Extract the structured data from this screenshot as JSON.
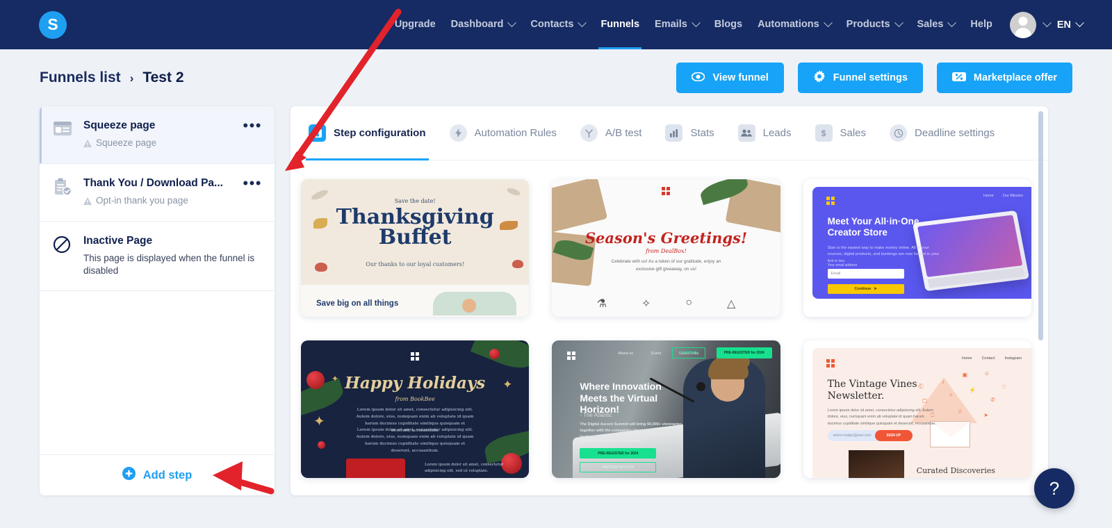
{
  "brand": {
    "logo_letter": "S",
    "accent": "#17a3f7",
    "navy": "#162b63"
  },
  "topnav": {
    "items": [
      {
        "label": "Upgrade",
        "caret": false,
        "active": false
      },
      {
        "label": "Dashboard",
        "caret": true,
        "active": false
      },
      {
        "label": "Contacts",
        "caret": true,
        "active": false
      },
      {
        "label": "Funnels",
        "caret": false,
        "active": true
      },
      {
        "label": "Emails",
        "caret": true,
        "active": false
      },
      {
        "label": "Blogs",
        "caret": false,
        "active": false
      },
      {
        "label": "Automations",
        "caret": true,
        "active": false
      },
      {
        "label": "Products",
        "caret": true,
        "active": false
      },
      {
        "label": "Sales",
        "caret": true,
        "active": false
      },
      {
        "label": "Help",
        "caret": false,
        "active": false
      }
    ],
    "language": "EN"
  },
  "header": {
    "breadcrumb_root": "Funnels list",
    "breadcrumb_sep": "›",
    "breadcrumb_current": "Test 2",
    "actions": [
      {
        "label": "View funnel",
        "icon": "eye-icon"
      },
      {
        "label": "Funnel settings",
        "icon": "gear-icon"
      },
      {
        "label": "Marketplace offer",
        "icon": "ticket-percent-icon"
      }
    ]
  },
  "sidebar": {
    "steps": [
      {
        "title": "Squeeze page",
        "subtitle": "Squeeze page",
        "warning": true,
        "selected": true,
        "icon": "squeeze-page-icon",
        "menu": "•••"
      },
      {
        "title": "Thank You / Download Pa...",
        "subtitle": "Opt-in thank you page",
        "warning": true,
        "selected": false,
        "icon": "thank-you-page-icon",
        "menu": "•••"
      },
      {
        "title": "Inactive Page",
        "subtitle": "This page is displayed when the funnel is disabled",
        "warning": false,
        "selected": false,
        "icon": "inactive-page-icon",
        "menu": ""
      }
    ],
    "add_step_label": "Add step"
  },
  "panel": {
    "tabs": [
      {
        "label": "Step configuration",
        "icon": "step-config-icon",
        "active": true
      },
      {
        "label": "Automation Rules",
        "icon": "bolt-icon",
        "active": false
      },
      {
        "label": "A/B test",
        "icon": "split-icon",
        "active": false
      },
      {
        "label": "Stats",
        "icon": "bar-chart-icon",
        "active": false
      },
      {
        "label": "Leads",
        "icon": "people-icon",
        "active": false
      },
      {
        "label": "Sales",
        "icon": "dollar-icon",
        "active": false
      },
      {
        "label": "Deadline settings",
        "icon": "clock-icon",
        "active": false
      }
    ],
    "templates": [
      {
        "name": "thanksgiving-buffet-template",
        "eyebrow": "Save the date!",
        "title": "Thanksgiving Buffet",
        "subtitle": "Our thanks to our loyal customers!",
        "footer": "Save big on all things"
      },
      {
        "name": "seasons-greetings-template",
        "title": "Season's Greetings!",
        "from": "from DealBox!",
        "description": "Celebrate with us! As a token of our gratitude, enjoy an exclusive gift giveaway, on us!"
      },
      {
        "name": "creator-store-template",
        "nav": [
          "Home",
          "Our Mission"
        ],
        "title": "Meet Your All·in·One Creator Store",
        "description": "Stan is the easiest way to make money online. All of your courses, digital products, and bookings are now hosted in your link in bio.",
        "field_label": "Your email address",
        "field_placeholder": "Email",
        "cta": "Continue"
      },
      {
        "name": "happy-holidays-template",
        "title": "Happy Holidays",
        "from": "from BookBee",
        "paragraph1": "Lorem ipsum dolor sit amet, consectetur adipisicing elit. Autem dolore, eius, numquam enim ab voluptate id quam harum ducimus cupiditate similique quisquam et deserunt, accusantium.",
        "paragraph2": "Lorem ipsum dolor sit amet, consectetur adipisicing elit. Autem dolore, eius, numquam enim ab voluptate id quam harum ducimus cupiditate similique quisquam et deserunt, accusantium.",
        "footer": "Lorem ipsum dolor sit amet, consectetur adipisicing elit, sed ut voluptate."
      },
      {
        "name": "virtual-summit-template",
        "nav": [
          "About us",
          "Event",
          "Useful links"
        ],
        "btn_ghost": "PARTNER",
        "btn_green": "PRE-REGISTER for 2024",
        "title": "Where Innovation Meets the Virtual Horizon!",
        "subtitle": "- The Atlantic",
        "paragraph": "The Digital Ascent Summit will bring 50,000+ visionaries together with the companies shaping the future digital landscape.",
        "paragraph2": "See you in Madrid next December.",
        "cta1": "PRE-REGISTER for 2024",
        "cta2": "PARTNER WITH US"
      },
      {
        "name": "vintage-vines-template",
        "nav": [
          "Home",
          "Contact",
          "Instagram"
        ],
        "title": "The Vintage Vines Newsletter.",
        "description": "Lorem ipsum dolor sit amet, consectetur adipisicing elit. Autem dolore, eius, numquam enim ab voluptate id quam harum ducimus cupiditate similique quisquam et deserunt, recusandae.",
        "field_placeholder": "wilson.hodge@peer.com",
        "cta": "SIGN UP",
        "footer": "Curated Discoveries"
      }
    ]
  },
  "help": {
    "label": "?"
  }
}
